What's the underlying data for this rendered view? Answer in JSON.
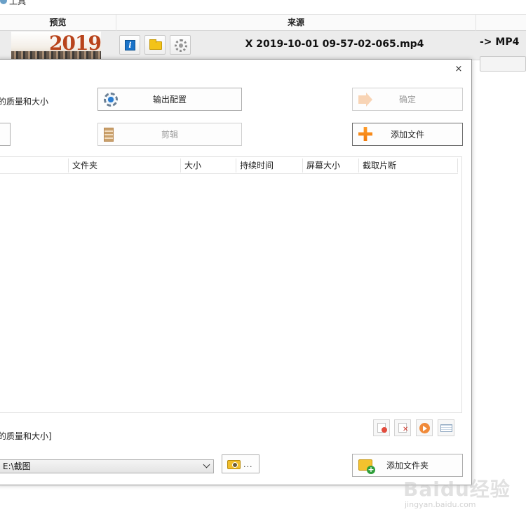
{
  "app": {
    "title": "工具"
  },
  "grid": {
    "headers": {
      "preview": "预览",
      "source": "来源"
    },
    "row": {
      "thumbnail_text": "2019",
      "source_file": "X 2019-10-01 09-57-02-065.mp4",
      "target": "-> MP4"
    }
  },
  "dialog": {
    "close": "×",
    "quality_label": "的质量和大小",
    "buttons": {
      "output_config": "输出配置",
      "ok": "确定",
      "clip": "剪辑",
      "add_file": "添加文件",
      "add_folder": "添加文件夹"
    },
    "columns": [
      "文件夹",
      "大小",
      "持续时间",
      "屏幕大小",
      "截取片断"
    ],
    "bottom_label": "的质量和大小]",
    "output_path": "E:\\截图",
    "browse_dots": "...",
    "colors": {
      "accent": "#f07a0c",
      "info_blue": "#1a73c9"
    }
  },
  "watermark": {
    "text": "Baidu经验",
    "url": "jingyan.baidu.com"
  }
}
